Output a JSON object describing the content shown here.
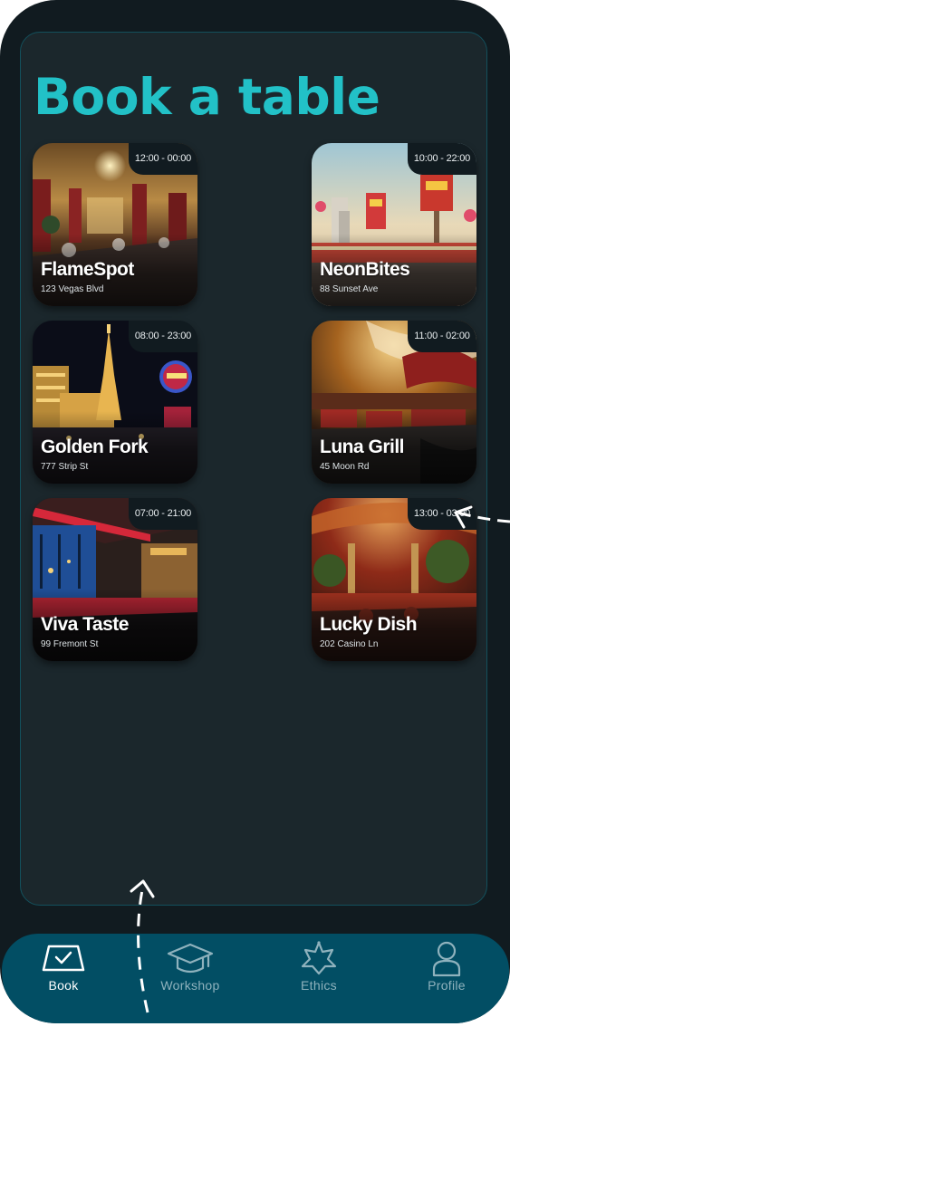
{
  "page_title": "Book a table",
  "restaurants": [
    {
      "name": "FlameSpot",
      "address": "123 Vegas Blvd",
      "hours": "12:00 - 00:00"
    },
    {
      "name": "NeonBites",
      "address": "88 Sunset Ave",
      "hours": "10:00 - 22:00"
    },
    {
      "name": "Golden Fork",
      "address": "777 Strip St",
      "hours": "08:00 - 23:00"
    },
    {
      "name": "Luna Grill",
      "address": "45 Moon Rd",
      "hours": "11:00 - 02:00"
    },
    {
      "name": "Viva Taste",
      "address": "99 Fremont St",
      "hours": "07:00 - 21:00"
    },
    {
      "name": "Lucky Dish",
      "address": "202 Casino Ln",
      "hours": "13:00 - 03:00"
    }
  ],
  "tabs": [
    {
      "label": "Book",
      "icon": "book-laptop-icon",
      "active": true
    },
    {
      "label": "Workshop",
      "icon": "graduation-cap-icon",
      "active": false
    },
    {
      "label": "Ethics",
      "icon": "star-badge-icon",
      "active": false
    },
    {
      "label": "Profile",
      "icon": "person-icon",
      "active": false
    }
  ],
  "colors": {
    "accent": "#22c1c7",
    "phone_bg": "#111b20",
    "screen_bg": "#1b272c",
    "tabbar_bg": "#024e64",
    "tab_inactive": "#8fb2bd"
  }
}
